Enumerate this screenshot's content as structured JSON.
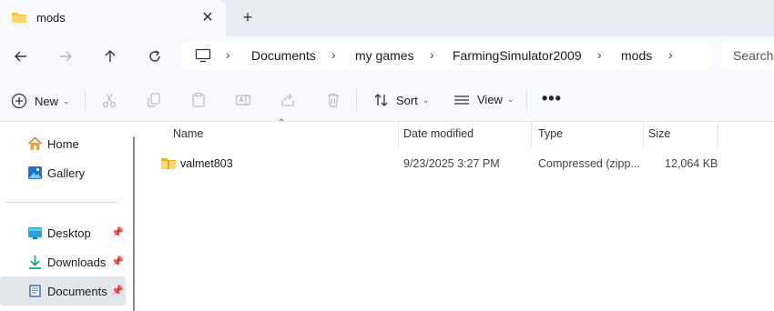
{
  "window": {
    "tab_title": "mods",
    "close_glyph": "✕",
    "new_tab_glyph": "+"
  },
  "nav": {
    "back_icon": "back-arrow-icon",
    "forward_icon": "forward-arrow-icon",
    "up_icon": "up-arrow-icon",
    "refresh_icon": "refresh-icon"
  },
  "address": {
    "breadcrumbs": [
      "Documents",
      "my games",
      "FarmingSimulator2009",
      "mods"
    ],
    "search_placeholder": "Search"
  },
  "toolbar": {
    "new_label": "New",
    "sort_label": "Sort",
    "view_label": "View",
    "more_glyph": "•••"
  },
  "sidebar": {
    "items": [
      {
        "label": "Home",
        "icon": "home-icon"
      },
      {
        "label": "Gallery",
        "icon": "gallery-icon"
      },
      {
        "label": "Desktop",
        "icon": "desktop-icon",
        "pinned": true
      },
      {
        "label": "Downloads",
        "icon": "downloads-icon",
        "pinned": true
      },
      {
        "label": "Documents",
        "icon": "documents-icon",
        "pinned": true,
        "selected": true
      }
    ]
  },
  "filelist": {
    "columns": [
      "Name",
      "Date modified",
      "Type",
      "Size"
    ],
    "rows": [
      {
        "name": "valmet803",
        "date": "9/23/2025 3:27 PM",
        "type": "Compressed (zipp...",
        "size": "12,064 KB",
        "icon": "zip-folder-icon"
      }
    ]
  },
  "colors": {
    "accent": "#0067c0",
    "folder_yellow": "#f4c542",
    "selected_bg": "#e3e6eb"
  }
}
